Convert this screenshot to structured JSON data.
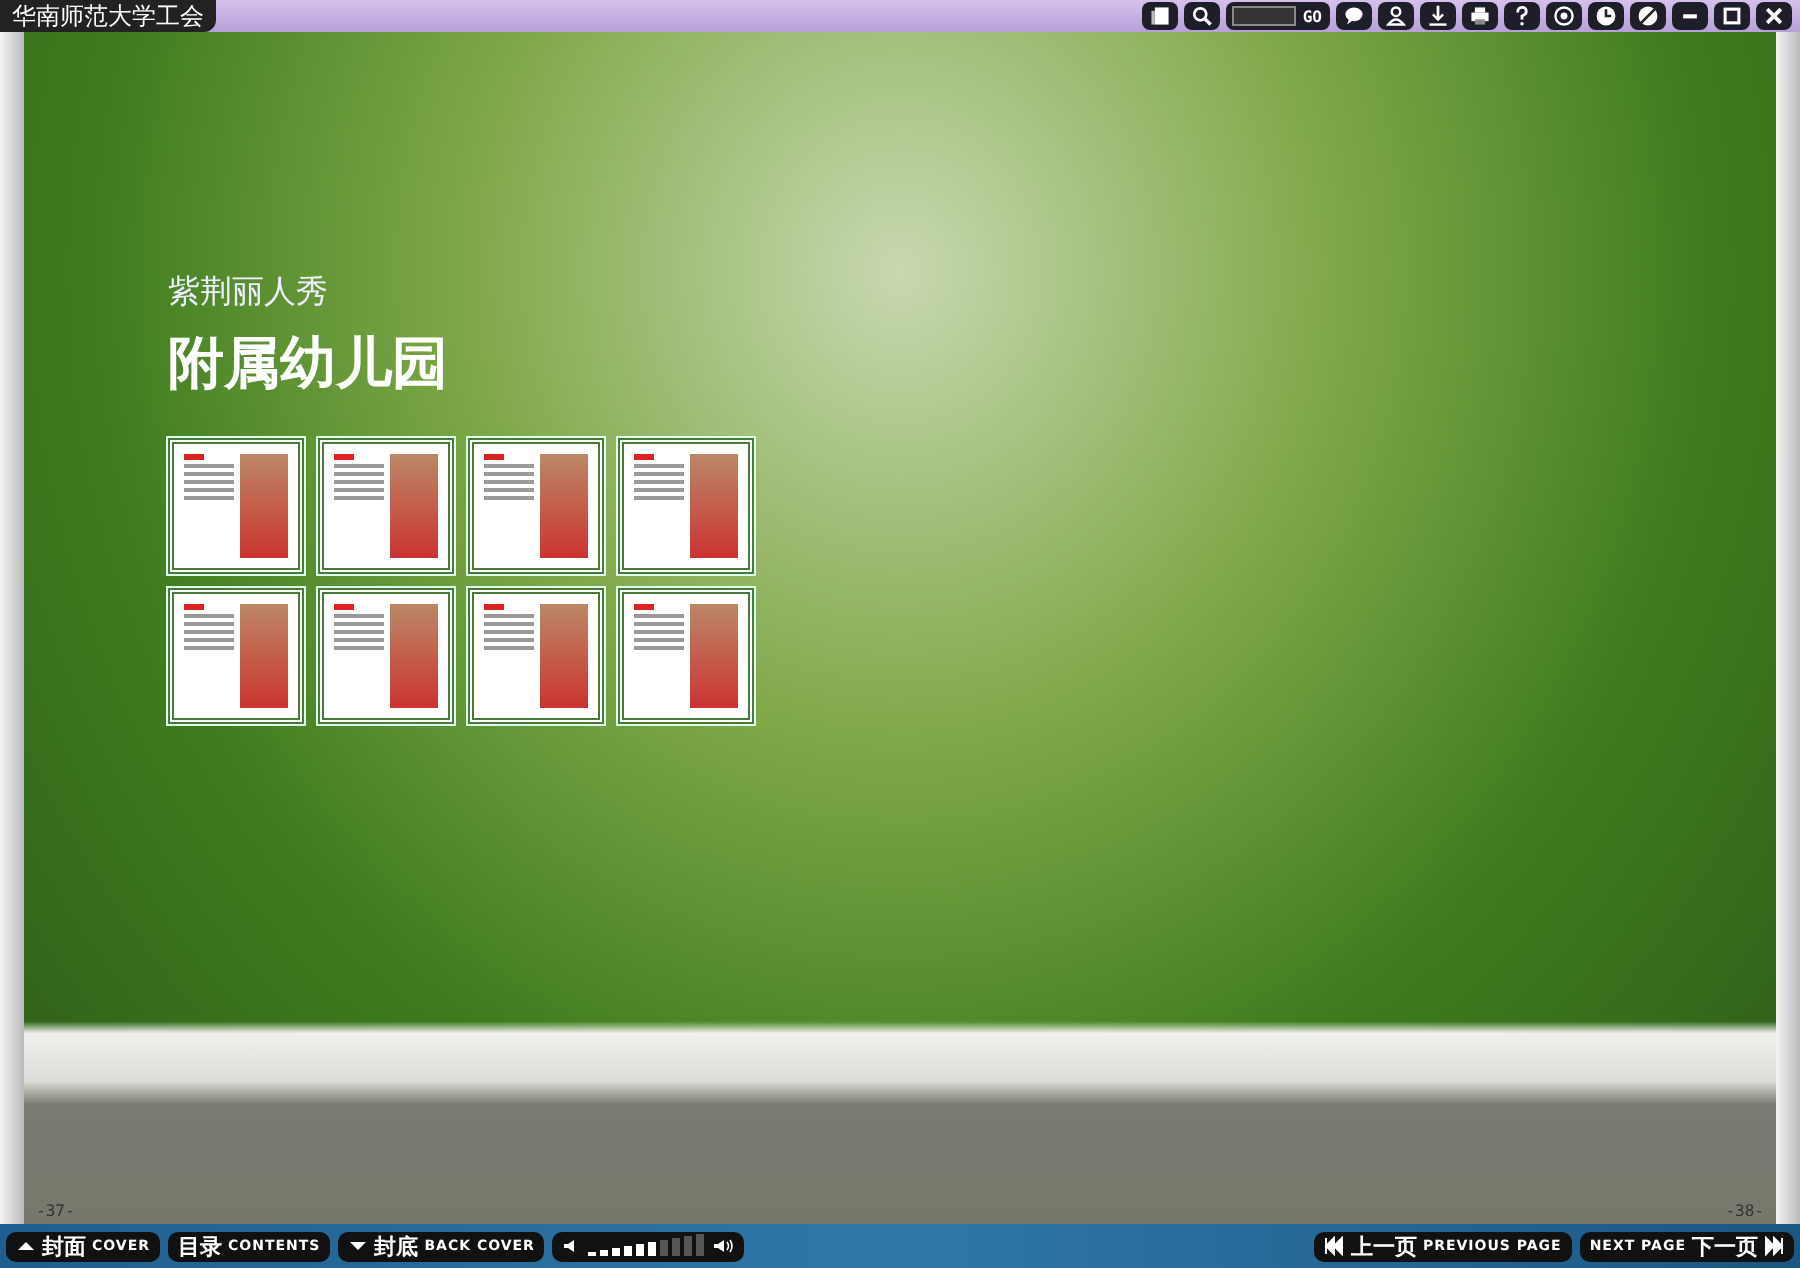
{
  "window": {
    "title": "华南师范大学工会"
  },
  "toolbar": {
    "go_button": "GO"
  },
  "page": {
    "subtitle": "紫荆丽人秀",
    "title": "附属幼儿园",
    "thumbnails": [
      {
        "kind": "photo"
      },
      {
        "kind": "photo"
      },
      {
        "kind": "photo"
      },
      {
        "kind": "photo"
      },
      {
        "kind": "photo"
      },
      {
        "kind": "photo"
      },
      {
        "kind": "photo"
      },
      {
        "kind": "photo"
      }
    ],
    "left_page_number": "-37-",
    "right_page_number": "-38-"
  },
  "bottom_bar": {
    "left_buttons": [
      {
        "kind": "up",
        "cn": "封面",
        "en": "COVER"
      },
      {
        "kind": "none",
        "cn": "目录",
        "en": "CONTENTS"
      },
      {
        "kind": "down",
        "cn": "封底",
        "en": "BACK COVER"
      }
    ],
    "volume": {
      "level": 0.6
    },
    "previous": {
      "cn": "上一页",
      "en": "PREVIOUS PAGE"
    },
    "next": {
      "en": "NEXT PAGE",
      "cn": "下一页"
    }
  }
}
